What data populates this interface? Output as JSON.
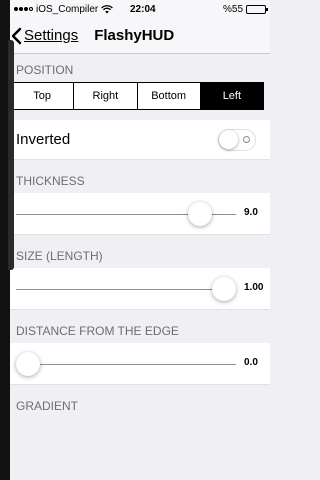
{
  "status_bar": {
    "carrier": "iOS_Compiler",
    "time": "22:04",
    "battery_percent": "%55",
    "battery_level": 0.55
  },
  "nav": {
    "back_label": "Settings",
    "title": "FlashyHUD"
  },
  "position": {
    "header": "POSITION",
    "options": [
      "Top",
      "Right",
      "Bottom",
      "Left"
    ],
    "selected": "Left"
  },
  "inverted": {
    "label": "Inverted",
    "on": false
  },
  "thickness": {
    "header": "THICKNESS",
    "value_text": "9.0",
    "level": 0.88
  },
  "size": {
    "header": "SIZE (LENGTH)",
    "value_text": "1.00",
    "level": 1.0
  },
  "distance": {
    "header": "DISTANCE FROM THE EDGE",
    "value_text": "0.0",
    "level": 0.0
  },
  "gradient": {
    "header": "GRADIENT"
  }
}
